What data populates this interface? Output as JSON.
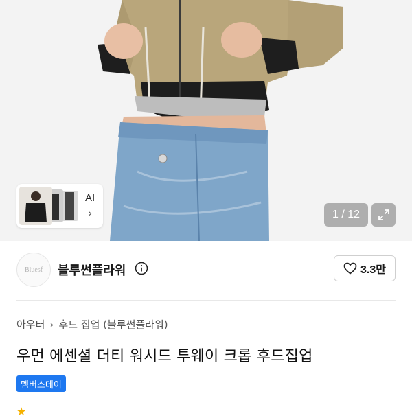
{
  "gallery": {
    "counter": "1 / 12",
    "ai_label": "AI"
  },
  "shop": {
    "logo_text": "Bluesf",
    "name": "블루썬플라워",
    "likes": "3.3만"
  },
  "breadcrumb": {
    "category": "아우터",
    "subcategory": "후드 집업 (블루썬플라워)"
  },
  "product": {
    "title": "우먼 에센셜 더티 워시드 투웨이 크롭 후드집업",
    "badge": "멤버스데이"
  },
  "colors": {
    "accent": "#1e78f0",
    "star": "#f5b100"
  }
}
